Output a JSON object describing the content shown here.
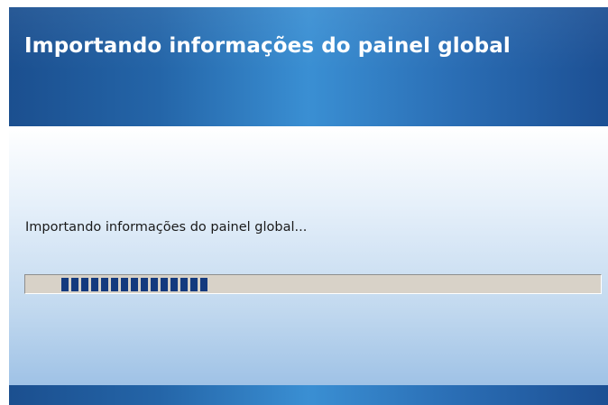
{
  "dialog": {
    "title": "Importando informações do painel global",
    "message": "Importando informações do painel global...",
    "progress": {
      "state": "indeterminate-marquee",
      "visible_block_count": 15
    }
  },
  "colors": {
    "header_blue": "#2465a8",
    "header_highlight": "#3a8fd3",
    "progress_track": "#d8d2c8",
    "progress_block": "#143a7e",
    "body_top": "#ffffff",
    "body_bottom": "#9fc2e6"
  }
}
